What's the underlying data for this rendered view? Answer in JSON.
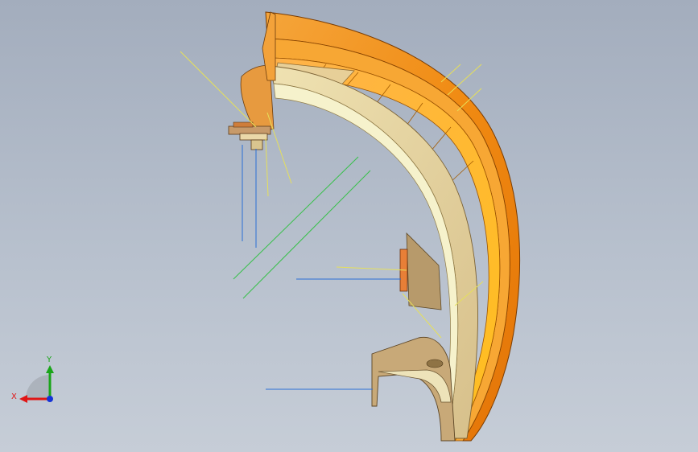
{
  "viewport": {
    "background_top": "#a3adbd",
    "background_bottom": "#c6cdd7"
  },
  "triad": {
    "x_label": "X",
    "y_label": "Y",
    "x_color": "#e01515",
    "y_color": "#1aa51a",
    "z_color": "#1533d6"
  },
  "model": {
    "fender_orange": "#f29a1a",
    "fender_dark": "#d96a05",
    "inner_tan": "#e8d9a6",
    "liner_pale": "#f4f1c9",
    "shadow_tan": "#b89a6a",
    "sketch_yellow": "#e6e05a",
    "sketch_green": "#37c04a",
    "sketch_blue": "#2a6fd6"
  }
}
